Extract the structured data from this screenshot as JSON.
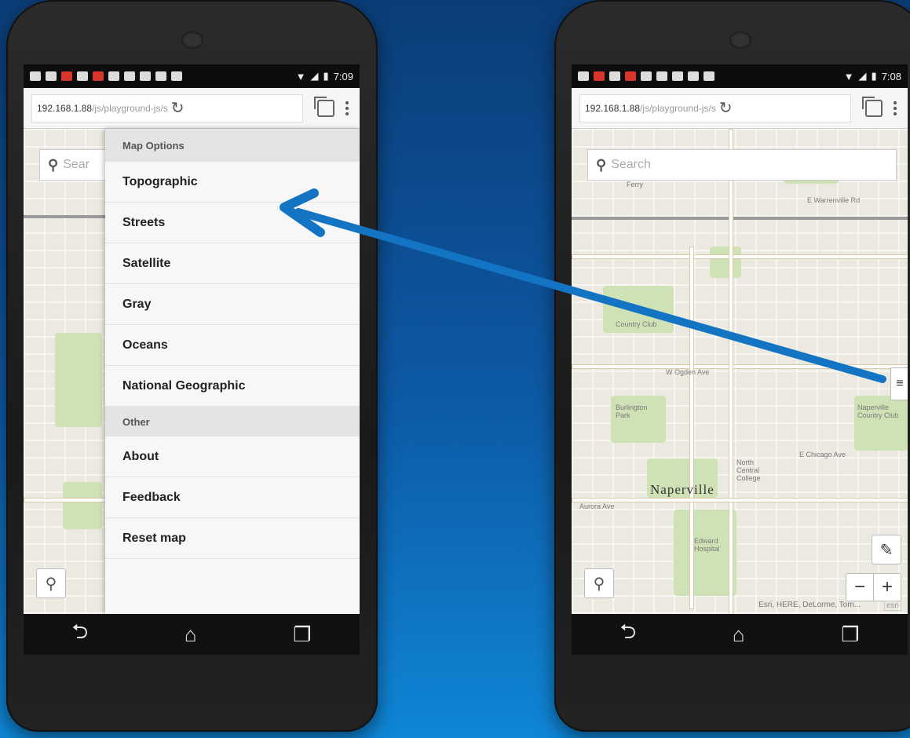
{
  "colors": {
    "arrow": "#1474c4",
    "background_top": "#0b3d78",
    "background_bottom": "#0f86d6"
  },
  "left_phone": {
    "status_time": "7:09",
    "url_host": "192.168.1.88",
    "url_path": "/js/playground-js/s",
    "search_placeholder": "Sear",
    "menu": {
      "section_map_options": "Map Options",
      "map_items": [
        "Topographic",
        "Streets",
        "Satellite",
        "Gray",
        "Oceans",
        "National Geographic"
      ],
      "section_other": "Other",
      "other_items": [
        "About",
        "Feedback",
        "Reset map"
      ]
    }
  },
  "right_phone": {
    "status_time": "7:08",
    "url_host": "192.168.1.88",
    "url_path": "/js/playground-js/s",
    "search_placeholder": "Search",
    "map_labels": {
      "city": "Naperville",
      "street_1": "Ferry",
      "street_2": "E Warrenville Rd",
      "street_3": "W Ogden Ave",
      "street_4": "E Chicago Ave",
      "street_5": "Aurora Ave",
      "park_1": "Country Club",
      "park_2": "Naperville Country Club",
      "park_3": "Burlington Park",
      "park_4": "North Central College",
      "park_5": "Edward Hospital"
    },
    "attribution": "Esri, HERE, DeLorme, Tom...",
    "esri_logo": "esri",
    "zoom_out": "−",
    "zoom_in": "+"
  },
  "icons": {
    "reload": "refresh-icon",
    "tabs": "tabs-icon",
    "overflow": "overflow-menu-icon",
    "search": "search-icon",
    "locate": "map-pin-icon",
    "back": "back-icon",
    "home": "home-icon",
    "recents": "recents-icon",
    "edit": "pencil-icon",
    "menu_toggle": "hamburger-icon"
  }
}
